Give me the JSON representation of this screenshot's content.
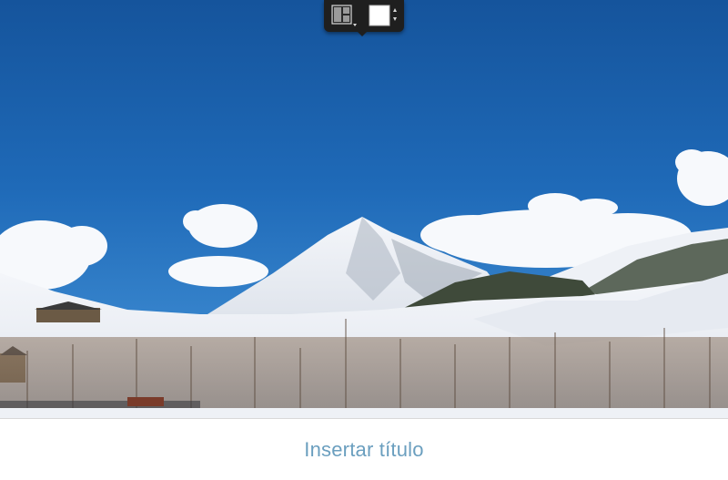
{
  "slide": {
    "title_placeholder": "Insertar título"
  },
  "photo": {
    "subject": "mountain-landscape"
  },
  "toolbar": {
    "layout_button_icon": "slide-layout-icon",
    "background_color_icon": "color-swatch-icon",
    "background_color": "#ffffff"
  },
  "colors": {
    "title_text": "#6b9fbf",
    "toolbar_bg": "#1f1f1f",
    "sky_top": "#17579f",
    "sky_bottom": "#3f8fd6"
  }
}
